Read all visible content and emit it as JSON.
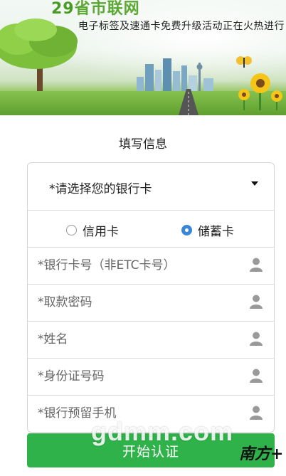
{
  "banner": {
    "brand_number": "29",
    "brand_name": "省市联网",
    "promo_text": "电子标签及速通卡免费升级活动正在火热进行"
  },
  "form": {
    "title": "填写信息",
    "bank_select_label": "*请选择您的银行卡",
    "card_type": {
      "options": [
        "信用卡",
        "储蓄卡"
      ],
      "selected": "储蓄卡"
    },
    "fields": {
      "card_number_placeholder": "*银行卡号（非ETC卡号）",
      "password_placeholder": "*取款密码",
      "name_placeholder": "*姓名",
      "id_number_placeholder": "*身份证号码",
      "phone_placeholder": "*银行预留手机"
    },
    "submit_label": "开始认证"
  },
  "watermarks": {
    "site": "gdmm.com",
    "logo": "南方+"
  },
  "colors": {
    "accent_green": "#2fb24a",
    "radio_blue": "#3a87d8"
  }
}
